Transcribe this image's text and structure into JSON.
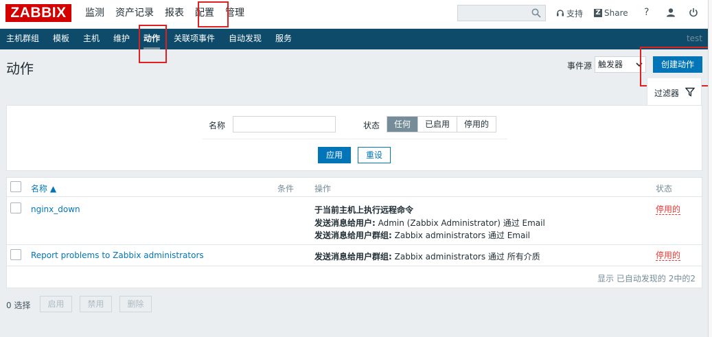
{
  "brand": {
    "logo": "ZABBIX",
    "logo_color": "#d40000"
  },
  "main_menu": [
    {
      "label": "监测"
    },
    {
      "label": "资产记录"
    },
    {
      "label": "报表"
    },
    {
      "label": "配置",
      "active": true
    },
    {
      "label": "管理"
    }
  ],
  "search": {
    "value": "",
    "placeholder": "",
    "icon": "search-icon"
  },
  "top_links": {
    "support": "支持",
    "share": "Share",
    "help": "?",
    "profile_icon": "user-icon",
    "logout_icon": "power-icon"
  },
  "sub_menu": [
    {
      "label": "主机群组"
    },
    {
      "label": "模板"
    },
    {
      "label": "主机"
    },
    {
      "label": "维护"
    },
    {
      "label": "动作",
      "active": true
    },
    {
      "label": "关联项事件"
    },
    {
      "label": "自动发现"
    },
    {
      "label": "服务"
    }
  ],
  "user_name": "test",
  "page": {
    "title": "动作",
    "event_source_label": "事件源",
    "event_source_value": "触发器",
    "create_button": "创建动作"
  },
  "filter": {
    "tab_label": "过滤器",
    "name_label": "名称",
    "name_value": "",
    "status_label": "状态",
    "status_options": [
      "任何",
      "已启用",
      "停用的"
    ],
    "status_selected": "任何",
    "apply_button": "应用",
    "reset_button": "重设"
  },
  "table": {
    "headers": {
      "name": "名称 ▲",
      "conditions": "条件",
      "operations": "操作",
      "status": "状态"
    },
    "rows": [
      {
        "name": "nginx_down",
        "operations": [
          {
            "bold": "于当前主机上执行远程命令",
            "text": ""
          },
          {
            "bold": "发送消息给用户:",
            "text": " Admin (Zabbix Administrator) 通过 Email"
          },
          {
            "bold": "发送消息给用户群组:",
            "text": " Zabbix administrators 通过 Email"
          }
        ],
        "status": "停用的"
      },
      {
        "name": "Report problems to Zabbix administrators",
        "operations": [
          {
            "bold": "发送消息给用户群组:",
            "text": " Zabbix administrators 通过 所有介质"
          }
        ],
        "status": "停用的"
      }
    ],
    "footer": "显示 已自动发现的 2中的2"
  },
  "mass_actions": {
    "selected": "0 选择",
    "enable": "启用",
    "disable": "禁用",
    "delete": "删除"
  },
  "colors": {
    "nav": "#0e4b6b",
    "link": "#0275b8",
    "disabled_status": "#e33734",
    "primary_button": "#0275b8"
  }
}
